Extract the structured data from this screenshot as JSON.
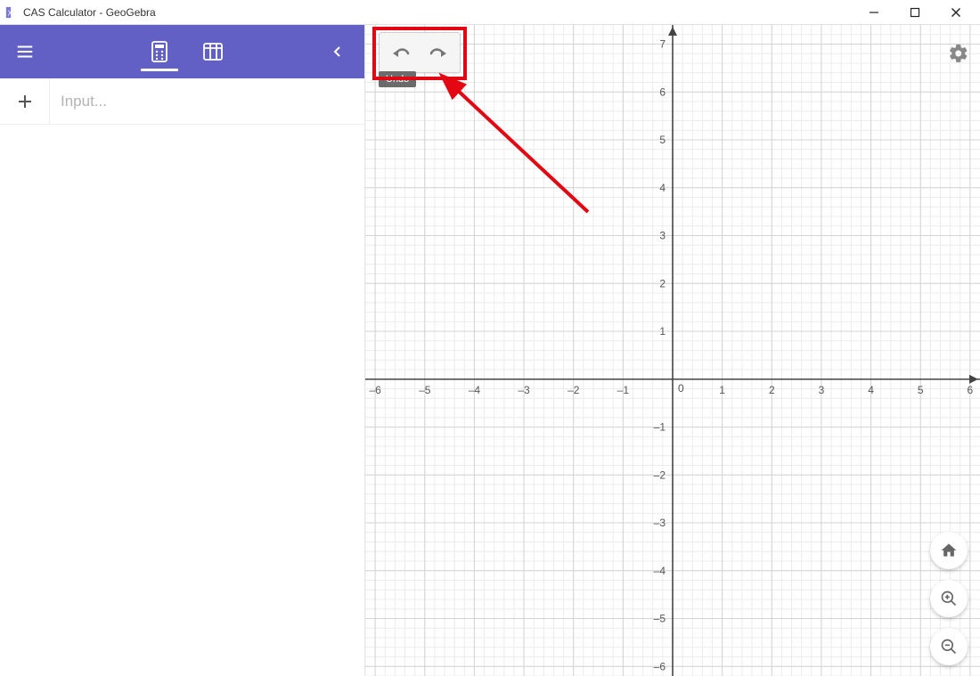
{
  "window": {
    "title": "CAS Calculator - GeoGebra"
  },
  "toolbar": {
    "menu_label": "Main menu",
    "tab_calculator": "Calculator",
    "tab_table": "Table",
    "collapse_label": "Collapse"
  },
  "input": {
    "placeholder": "Input..."
  },
  "canvas": {
    "undo_label": "Undo",
    "redo_label": "Redo",
    "settings_label": "Settings",
    "home_label": "Home",
    "zoom_in_label": "Zoom In",
    "zoom_out_label": "Zoom Out"
  },
  "tooltip": {
    "text": "Undo"
  },
  "chart_data": {
    "type": "scatter",
    "series": [],
    "xlabel": "",
    "ylabel": "",
    "x_ticks": [
      -6,
      -5,
      -4,
      -3,
      -2,
      -1,
      0,
      1,
      2,
      3,
      4,
      5,
      6
    ],
    "y_ticks": [
      -6,
      -5,
      -4,
      -3,
      -2,
      -1,
      1,
      2,
      3,
      4,
      5,
      6,
      7
    ],
    "xlim": [
      -6.2,
      6.2
    ],
    "ylim": [
      -6.2,
      7.4
    ]
  }
}
